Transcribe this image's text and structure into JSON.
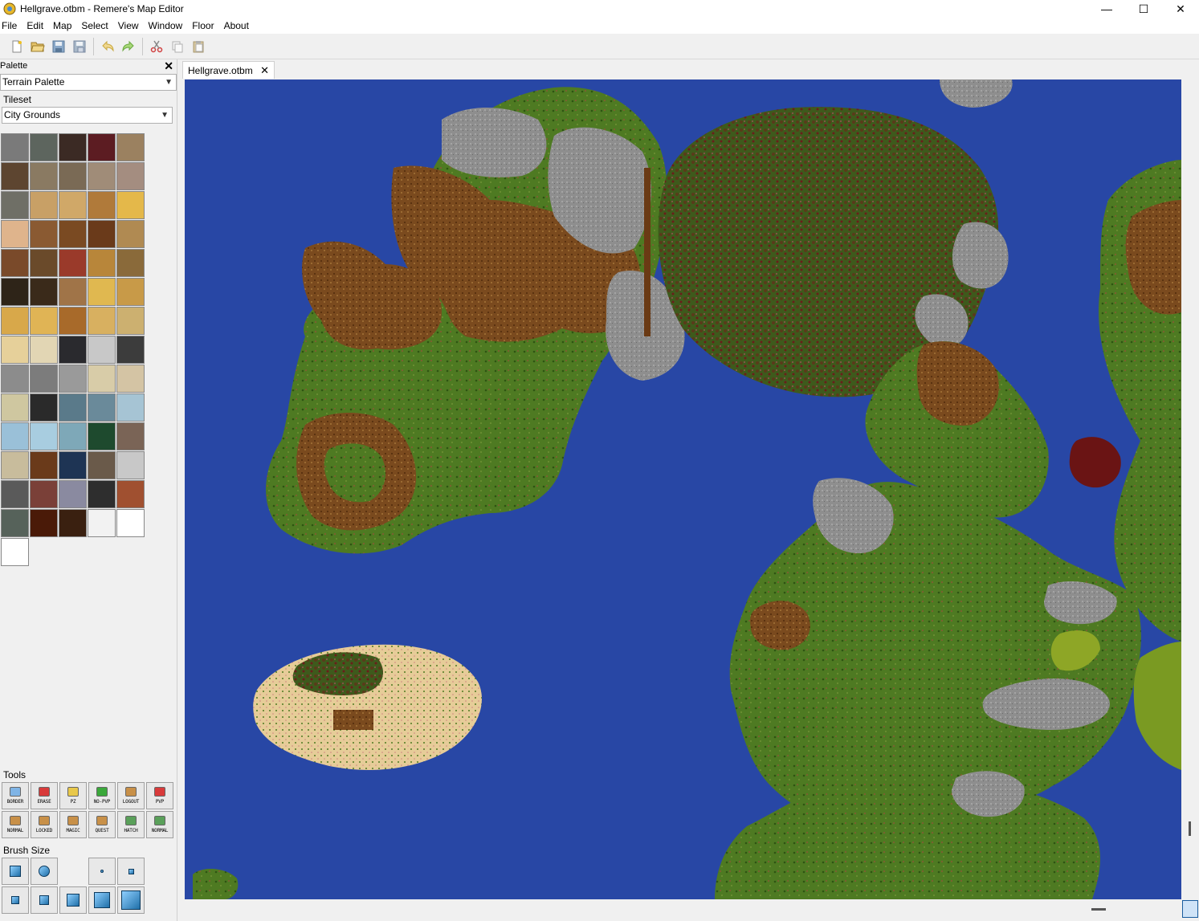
{
  "window": {
    "title": "Hellgrave.otbm - Remere's Map Editor",
    "minimize_glyph": "—",
    "maximize_glyph": "☐",
    "close_glyph": "✕"
  },
  "menu": [
    "File",
    "Edit",
    "Map",
    "Select",
    "View",
    "Window",
    "Floor",
    "About"
  ],
  "toolbar": {
    "icons": [
      "new-file-icon",
      "open-file-icon",
      "save-file-icon",
      "save-as-icon",
      "undo-icon",
      "redo-icon",
      "cut-icon",
      "copy-icon",
      "paste-icon"
    ]
  },
  "palette": {
    "header": "Palette",
    "close_glyph": "✕",
    "palette_type": "Terrain Palette",
    "tileset_label": "Tileset",
    "tileset_value": "City Grounds",
    "tile_colors": [
      "#7a7a7a",
      "#5d655e",
      "#3b2a24",
      "#5c1c22",
      "#9b8160",
      "#5d4530",
      "#8a7a62",
      "#7a6a55",
      "#a08c78",
      "#a48d80",
      "#6f6f66",
      "#c8a066",
      "#d0a868",
      "#b07a3a",
      "#e4b84a",
      "#dfb48c",
      "#8a5a32",
      "#7a4a22",
      "#6a3a1a",
      "#b08a52",
      "#7a4a2a",
      "#6a4a2a",
      "#9a3a2a",
      "#b8863a",
      "#8a6a3a",
      "#2e2418",
      "#3a2a1a",
      "#a07448",
      "#e0b850",
      "#c89a48",
      "#d8a84a",
      "#e0b455",
      "#a86a2a",
      "#d8b060",
      "#ccb070",
      "#e6d09a",
      "#e2d6b4",
      "#2a2a2e",
      "#c8c8c8",
      "#3c3c3c",
      "#8c8c8c",
      "#7c7c7c",
      "#9a9a9a",
      "#d8cca8",
      "#d4c4a4",
      "#cfc7a0",
      "#2a2a2a",
      "#5a7a8a",
      "#6a8a9a",
      "#a6c4d4",
      "#9ac0d8",
      "#a8cde0",
      "#7ea8b8",
      "#1e4a2e",
      "#7a6456",
      "#c8bc9c",
      "#6a3a1a",
      "#1e3454",
      "#6a5a4a",
      "#c8c8c8",
      "#5a5a5a",
      "#7a4038",
      "#8a8aa0",
      "#2e2e2e",
      "#a05030",
      "#56625a",
      "#4a1a08",
      "#3a2010",
      "#f2f2f2",
      "#ffffff",
      "#ffffff"
    ]
  },
  "tools": {
    "label": "Tools",
    "items": [
      {
        "label": "BORDER",
        "icon": "border-tool-icon",
        "color": "#7fb4e6"
      },
      {
        "label": "ERASE",
        "icon": "erase-tool-icon",
        "color": "#d83a3a"
      },
      {
        "label": "PZ",
        "icon": "pz-tool-icon",
        "color": "#e8c84a"
      },
      {
        "label": "NO-PVP",
        "icon": "no-pvp-tool-icon",
        "color": "#3aa83a"
      },
      {
        "label": "LOGOUT",
        "icon": "logout-tool-icon",
        "color": "#c89048"
      },
      {
        "label": "PVP",
        "icon": "pvp-tool-icon",
        "color": "#d83a3a"
      },
      {
        "label": "NORMAL",
        "icon": "normal-door-icon",
        "color": "#c89048"
      },
      {
        "label": "LOCKED",
        "icon": "locked-door-icon",
        "color": "#c89048"
      },
      {
        "label": "MAGIC",
        "icon": "magic-door-icon",
        "color": "#c89048"
      },
      {
        "label": "QUEST",
        "icon": "quest-door-icon",
        "color": "#c89048"
      },
      {
        "label": "HATCH",
        "icon": "hatch-icon",
        "color": "#5aa05a"
      },
      {
        "label": "NORMAL",
        "icon": "normal-window-icon",
        "color": "#5aa05a"
      }
    ]
  },
  "brush": {
    "label": "Brush Size",
    "sizes": [
      {
        "name": "brush-square-icon",
        "size": 14,
        "round": false
      },
      {
        "name": "brush-circle-icon",
        "size": 14,
        "round": true
      },
      {
        "name": "",
        "size": 0,
        "round": false
      },
      {
        "name": "brush-size-1-icon",
        "size": 4,
        "round": true
      },
      {
        "name": "brush-size-2-icon",
        "size": 7,
        "round": false
      },
      {
        "name": "brush-size-3-icon",
        "size": 10,
        "round": false
      },
      {
        "name": "brush-size-4-icon",
        "size": 12,
        "round": false
      },
      {
        "name": "brush-size-5-icon",
        "size": 16,
        "round": false
      },
      {
        "name": "brush-size-6-icon",
        "size": 20,
        "round": false
      },
      {
        "name": "brush-size-7-icon",
        "size": 24,
        "round": false
      }
    ]
  },
  "document": {
    "tab": "Hellgrave.otbm",
    "tab_close": "✕"
  },
  "map": {
    "water_color": "#2847a5",
    "grass_color": "#4e7a22",
    "rock_color": "#8e8e8e",
    "dirt_color": "#7a4a1e",
    "sand_color": "#e6cc98",
    "jungle_color": "#8ea626"
  }
}
